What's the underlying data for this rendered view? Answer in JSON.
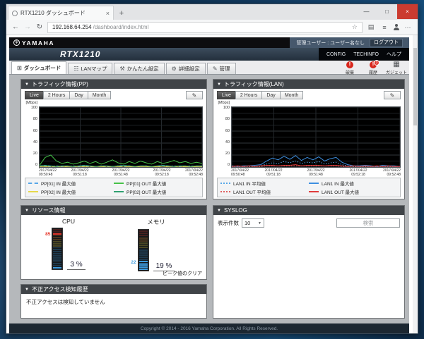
{
  "icons": {
    "back": "←",
    "forward": "→",
    "refresh": "↻",
    "star": "☆",
    "reader": "▤",
    "hub": "≡",
    "dots": "···",
    "plus": "+",
    "minimize": "—",
    "maximize": "□",
    "close": "×",
    "collapse": "▼",
    "dropdown": "▼",
    "alert": "!",
    "gadget": "▦",
    "dashboard": "⊞",
    "lanmap": "☷",
    "easy": "⚒",
    "advanced": "⚙",
    "manage": "✎",
    "pencil": "✎",
    "logo": "ψ"
  },
  "browser": {
    "tab_title": "RTX1210 ダッシュボード",
    "url_host": "192.168.64.254",
    "url_path": "/dashboard/index.html"
  },
  "header": {
    "brand": "YAMAHA",
    "model": "RTX1210",
    "user": "管理ユーザー : ユーザー名なし",
    "logout": "ログアウト",
    "links": [
      "CONFIG",
      "TECHINFO",
      "ヘルプ"
    ]
  },
  "nav": {
    "tabs": [
      {
        "label": "ダッシュボード",
        "active": true
      },
      {
        "label": "LANマップ"
      },
      {
        "label": "かんたん設定"
      },
      {
        "label": "詳細設定"
      },
      {
        "label": "管理"
      }
    ],
    "status": [
      {
        "label": "破棄"
      },
      {
        "label": "履歴",
        "badge": "3"
      },
      {
        "label": "ガジェット"
      }
    ]
  },
  "panels": {
    "pp": {
      "title": "トラフィック情報(PP)",
      "range_buttons": [
        "Live",
        "2 Hours",
        "Day",
        "Month"
      ],
      "active_range": "Live"
    },
    "lan": {
      "title": "トラフィック情報(LAN)",
      "range_buttons": [
        "Live",
        "2 Hours",
        "Day",
        "Month"
      ],
      "active_range": "Live"
    },
    "resource": {
      "title": "リソース情報",
      "clear_link": "ピーク値のクリア"
    },
    "syslog": {
      "title": "SYSLOG",
      "count_label": "表示件数",
      "count_value": "10",
      "search_placeholder": "検索"
    },
    "intrusion": {
      "title": "不正アクセス検知履歴",
      "message": "不正アクセスは検知していません"
    }
  },
  "resource": {
    "cpu": {
      "label": "CPU",
      "value": 3,
      "peak": 85,
      "unit": "%"
    },
    "memory": {
      "label": "メモリ",
      "value": 19,
      "peak": 22,
      "unit": "%"
    }
  },
  "chart_data": [
    {
      "id": "pp-traffic",
      "type": "line",
      "title": "トラフィック情報(PP)",
      "ylabel": "[Mbps]",
      "ylim": [
        0,
        100
      ],
      "yticks": [
        100,
        80,
        60,
        40,
        20,
        0
      ],
      "grid": "on",
      "legend_position": "bottom",
      "xticks": [
        {
          "date": "2017/04/22",
          "time": "09:50:48"
        },
        {
          "date": "2017/04/22",
          "time": "09:51:18"
        },
        {
          "date": "2017/04/22",
          "time": "09:51:48"
        },
        {
          "date": "2017/04/22",
          "time": "09:52:18"
        },
        {
          "date": "2017/04/22",
          "time": "09:52:48"
        }
      ],
      "series": [
        {
          "name": "PP[01] IN 最大値",
          "color": "#57a7e8",
          "dash": "dashed",
          "values": [
            1,
            2,
            1,
            2,
            1,
            1,
            2,
            1,
            2,
            1,
            1,
            2,
            1,
            1,
            2,
            1,
            2,
            1,
            1,
            2,
            1,
            1,
            2,
            1,
            2,
            1,
            1,
            2,
            1,
            1
          ]
        },
        {
          "name": "PP[01] OUT 最大値",
          "color": "#45c148",
          "dash": "solid",
          "values": [
            3,
            16,
            20,
            10,
            6,
            8,
            5,
            7,
            10,
            6,
            9,
            5,
            8,
            12,
            7,
            5,
            9,
            6,
            10,
            7,
            5,
            9,
            6,
            8,
            11,
            7,
            9,
            6,
            8,
            6
          ]
        },
        {
          "name": "PP[02] IN 最大値",
          "color": "#e6d84a",
          "dash": "solid",
          "values": [
            1,
            1,
            0,
            1,
            0,
            1,
            1,
            0,
            1,
            0,
            1,
            1,
            0,
            1,
            1,
            0,
            1,
            0,
            1,
            1,
            0,
            1,
            0,
            1,
            1,
            0,
            1,
            0,
            1,
            1
          ]
        },
        {
          "name": "PP[02] OUT 最大値",
          "color": "#2fa070",
          "dash": "solid",
          "values": [
            2,
            3,
            2,
            1,
            2,
            2,
            1,
            2,
            3,
            2,
            1,
            2,
            2,
            1,
            2,
            3,
            2,
            1,
            2,
            2,
            1,
            2,
            3,
            2,
            1,
            2,
            2,
            1,
            2,
            2
          ]
        }
      ]
    },
    {
      "id": "lan-traffic",
      "type": "line",
      "title": "トラフィック情報(LAN)",
      "ylabel": "[Mbps]",
      "ylim": [
        0,
        100
      ],
      "yticks": [
        100,
        80,
        60,
        40,
        20,
        0
      ],
      "grid": "on",
      "legend_position": "bottom",
      "xticks": [
        {
          "date": "2017/04/22",
          "time": "09:50:48"
        },
        {
          "date": "2017/04/22",
          "time": "09:51:18"
        },
        {
          "date": "2017/04/22",
          "time": "09:51:48"
        },
        {
          "date": "2017/04/22",
          "time": "09:52:18"
        },
        {
          "date": "2017/04/22",
          "time": "09:52:48"
        }
      ],
      "series": [
        {
          "name": "LAN1 IN 平均値",
          "color": "#57a7e8",
          "dash": "dotted",
          "values": [
            1,
            1,
            1,
            1,
            1,
            2,
            5,
            7,
            6,
            9,
            7,
            10,
            6,
            8,
            7,
            9,
            5,
            7,
            8,
            4,
            2,
            1,
            1,
            1,
            1,
            1,
            1,
            1,
            1,
            1
          ]
        },
        {
          "name": "LAN1 IN 最大値",
          "color": "#3d8fe0",
          "dash": "solid",
          "values": [
            2,
            1,
            2,
            2,
            3,
            4,
            10,
            15,
            12,
            18,
            13,
            19,
            11,
            16,
            12,
            17,
            10,
            14,
            16,
            8,
            4,
            2,
            2,
            3,
            2,
            1,
            3,
            2,
            2,
            1
          ]
        },
        {
          "name": "LAN1 OUT 平均値",
          "color": "#e06060",
          "dash": "dotted",
          "values": [
            1,
            1,
            1,
            1,
            1,
            1,
            2,
            2,
            2,
            2,
            2,
            2,
            2,
            2,
            2,
            2,
            2,
            2,
            2,
            1,
            1,
            1,
            1,
            1,
            1,
            1,
            1,
            1,
            1,
            1
          ]
        },
        {
          "name": "LAN1 OUT 最大値",
          "color": "#e03c3c",
          "dash": "solid",
          "values": [
            1,
            2,
            1,
            2,
            1,
            2,
            3,
            3,
            2,
            3,
            3,
            4,
            2,
            3,
            3,
            3,
            2,
            3,
            3,
            2,
            1,
            2,
            1,
            2,
            1,
            2,
            1,
            2,
            1,
            1
          ]
        }
      ]
    }
  ],
  "footer": {
    "copyright": "Copyright © 2014 - 2016 Yamaha Corporation. All Rights Reserved."
  }
}
